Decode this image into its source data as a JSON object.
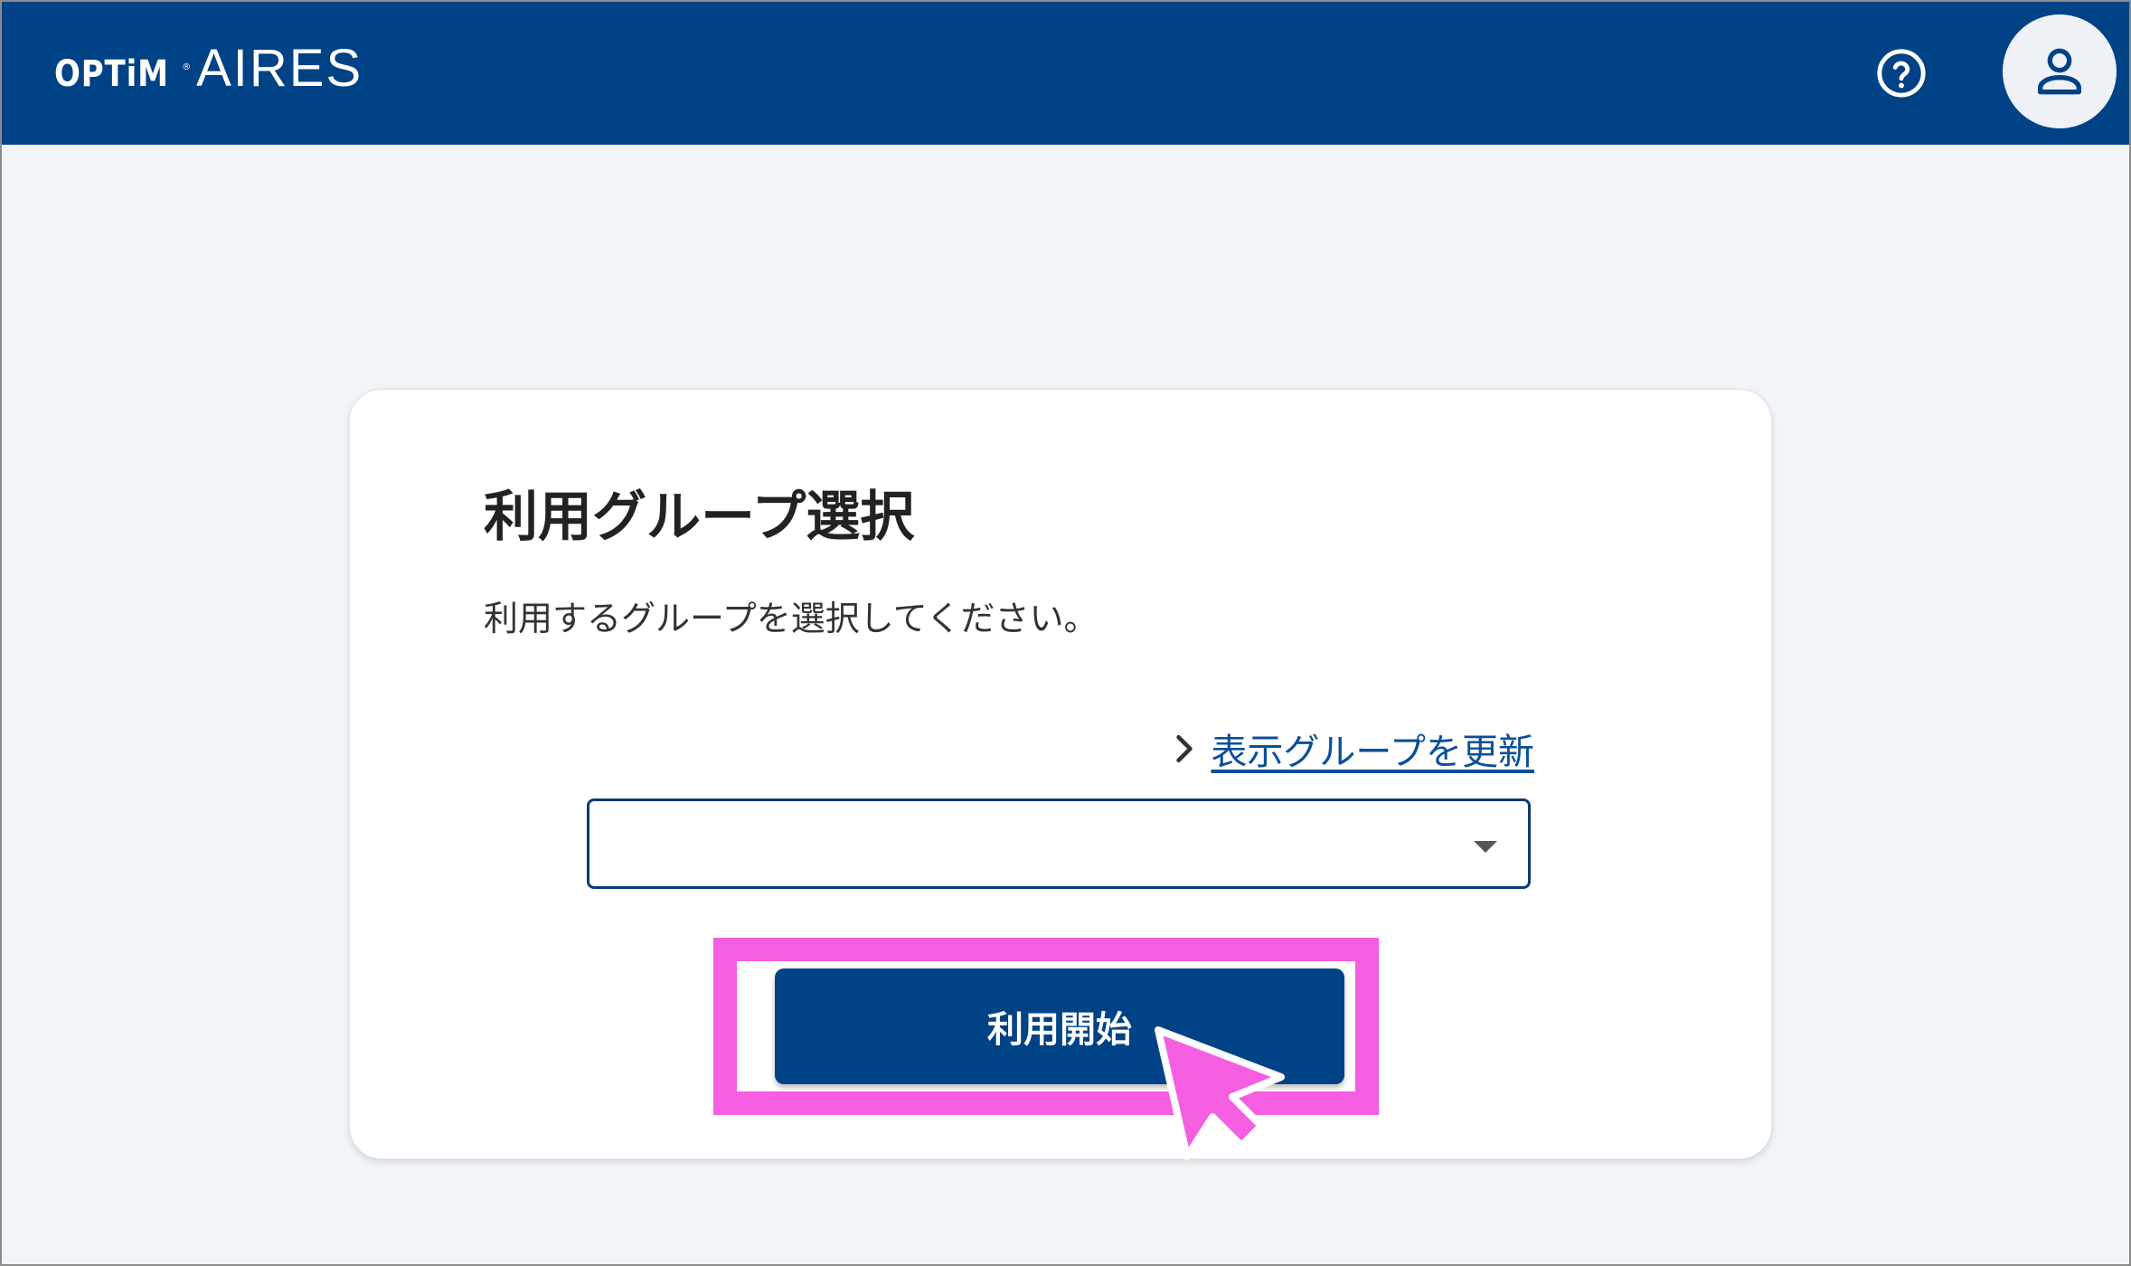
{
  "header": {
    "brand_optim": "OPTiM",
    "brand_reg": "®",
    "brand_product": "AIRES",
    "accent_color": "#004286"
  },
  "icons": {
    "help": "help-circle-icon",
    "account": "person-icon",
    "link_chevron": "chevron-right-icon",
    "select_caret": "caret-down-icon",
    "pointer": "pointer-arrow-icon"
  },
  "card": {
    "title": "利用グループ選択",
    "description": "利用するグループを選択してください。",
    "refresh_link": "表示グループを更新",
    "group_select": {
      "value": ""
    },
    "start_button": "利用開始",
    "highlight_color": "#f55ee0"
  }
}
